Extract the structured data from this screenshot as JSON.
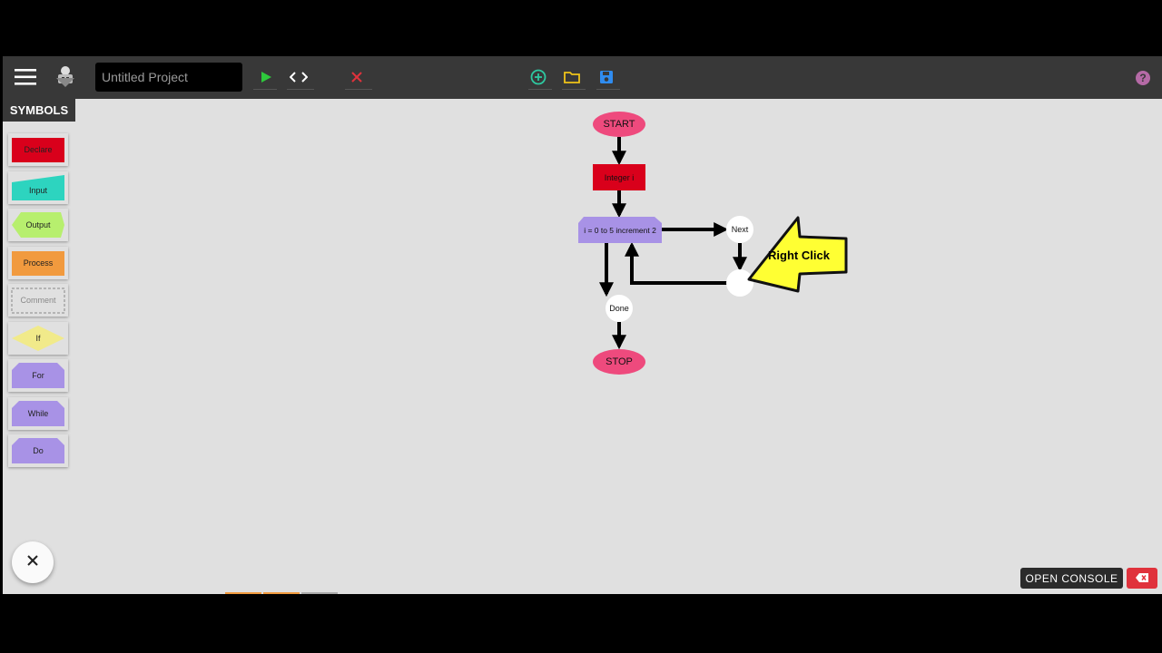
{
  "toolbar": {
    "menu_icon": "hamburger-menu-icon",
    "logo_icon": "robot-logo-icon",
    "project_name_placeholder": "Untitled Project",
    "run_icon": "play-icon",
    "code_icon": "code-brackets-icon",
    "stop_icon": "close-x-icon",
    "new_icon": "plus-circle-icon",
    "open_icon": "folder-icon",
    "save_icon": "floppy-disk-icon",
    "help_icon": "question-circle-icon"
  },
  "sidebar": {
    "title": "SYMBOLS",
    "items": [
      {
        "label": "Declare",
        "color": "#d9001b"
      },
      {
        "label": "Input",
        "color": "#2dd4bf"
      },
      {
        "label": "Output",
        "color": "#b7ef6e"
      },
      {
        "label": "Process",
        "color": "#f19a3e"
      },
      {
        "label": "Comment",
        "color": "#e0e0e0"
      },
      {
        "label": "If",
        "color": "#f1ea8a"
      },
      {
        "label": "For",
        "color": "#a892e6"
      },
      {
        "label": "While",
        "color": "#a892e6"
      },
      {
        "label": "Do",
        "color": "#a892e6"
      }
    ]
  },
  "flowchart": {
    "start": "START",
    "declare": "Integer i",
    "for_loop": "i = 0 to 5 increment 2",
    "next": "Next",
    "done": "Done",
    "stop": "STOP",
    "callout": "Right Click"
  },
  "colors": {
    "terminal": "#ee4a7d",
    "declare": "#d9001b",
    "loop": "#a892e6",
    "callout": "#ffff33"
  },
  "footer": {
    "open_console": "OPEN CONSOLE",
    "clear_console_icon": "backspace-x-icon",
    "close_fab_icon": "close-icon"
  }
}
